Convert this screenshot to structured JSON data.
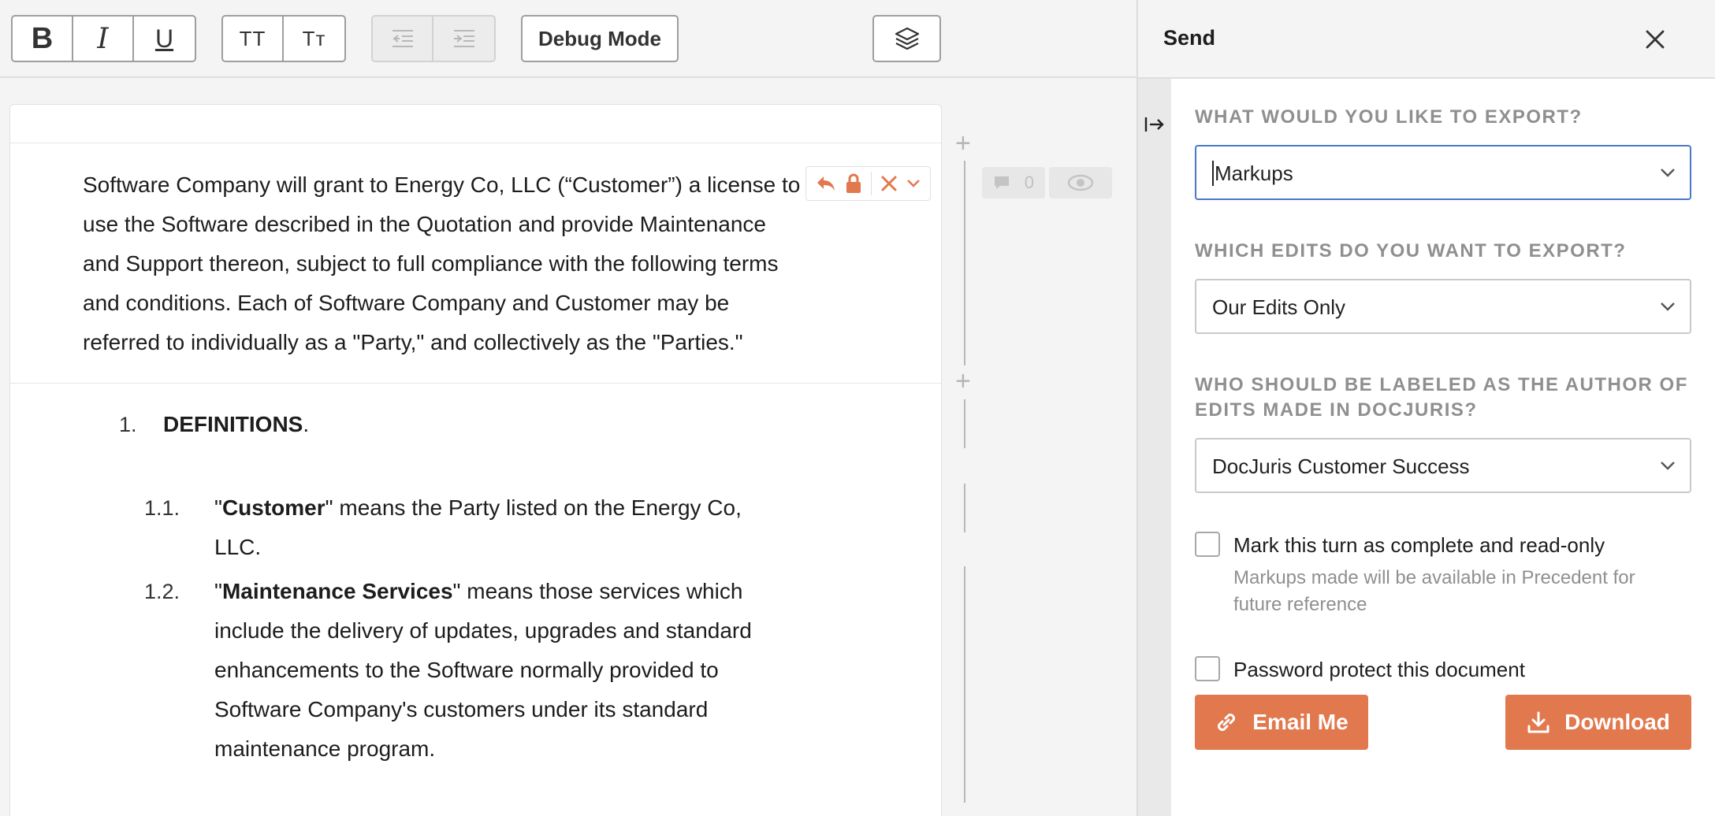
{
  "toolbar": {
    "format_buttons": [
      "B",
      "I",
      "U"
    ],
    "case_buttons": [
      "TT",
      "Tт"
    ],
    "debug_label": "Debug Mode"
  },
  "document": {
    "intro": "Software Company will grant to Energy Co, LLC (“Customer”) a license to use the Software described in the Quotation and provide Maintenance and Support thereon, subject to full compliance with the following terms and conditions.  Each of Software Company and Customer may be referred to individually as a \"Party,\" and collectively as the \"Parties.\"",
    "section": {
      "number": "1.",
      "title": "DEFINITIONS",
      "suffix": "."
    },
    "definitions": [
      {
        "number": "1.1.",
        "open_quote": "\"",
        "term": "Customer",
        "rest": "\" means the Party listed on the Energy Co, LLC."
      },
      {
        "number": "1.2.",
        "open_quote": "\"",
        "term": "Maintenance Services",
        "rest": "\" means those services which include the delivery of updates, upgrades and standard enhancements to the Software normally provided to Software Company's customers under its standard maintenance program."
      }
    ],
    "comment_count": "0"
  },
  "panel": {
    "title": "Send",
    "q_export": "WHAT WOULD YOU LIKE TO EXPORT?",
    "export_value": "Markups",
    "q_edits": "WHICH EDITS DO YOU WANT TO EXPORT?",
    "edits_value": "Our Edits Only",
    "q_author": "WHO SHOULD BE LABELED AS THE AUTHOR OF EDITS MADE IN DOCJURIS?",
    "author_value": "DocJuris Customer Success",
    "mark_complete_label": "Mark this turn as complete and read-only",
    "mark_complete_hint": "Markups made will be available in Precedent for future reference",
    "password_label": "Password protect this document",
    "email_label": "Email Me",
    "download_label": "Download"
  },
  "colors": {
    "accent": "#e2784d",
    "focus": "#4a78c9",
    "muted": "#8f8f8f"
  },
  "icons": [
    "bold-icon",
    "italic-icon",
    "underline-icon",
    "layers-icon",
    "reply-icon",
    "lock-icon",
    "reject-icon",
    "chevron-down-icon",
    "comment-icon",
    "visibility-icon",
    "close-icon",
    "collapse-panel-icon",
    "link-icon",
    "download-icon"
  ]
}
